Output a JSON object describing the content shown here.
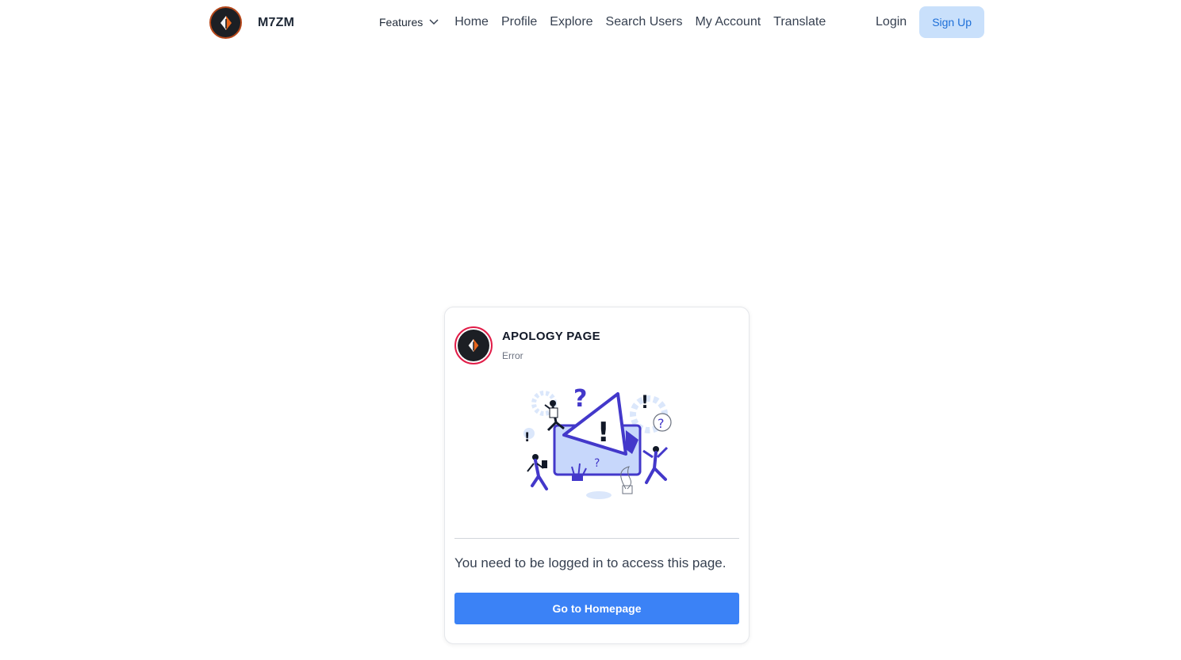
{
  "header": {
    "brand_name": "M7ZM",
    "features_label": "Features",
    "nav": [
      {
        "label": "Home"
      },
      {
        "label": "Profile"
      },
      {
        "label": "Explore"
      },
      {
        "label": "Search Users"
      },
      {
        "label": "My Account"
      },
      {
        "label": "Translate"
      }
    ],
    "login_label": "Login",
    "signup_label": "Sign Up"
  },
  "card": {
    "title": "APOLOGY PAGE",
    "subtitle": "Error",
    "message": "You need to be logged in to access this page.",
    "button_label": "Go to Homepage"
  },
  "colors": {
    "primary": "#3b82f6",
    "signup_bg": "#c9e0fb",
    "accent_ring": "#e11d48",
    "illustration_purple": "#4338ca"
  }
}
